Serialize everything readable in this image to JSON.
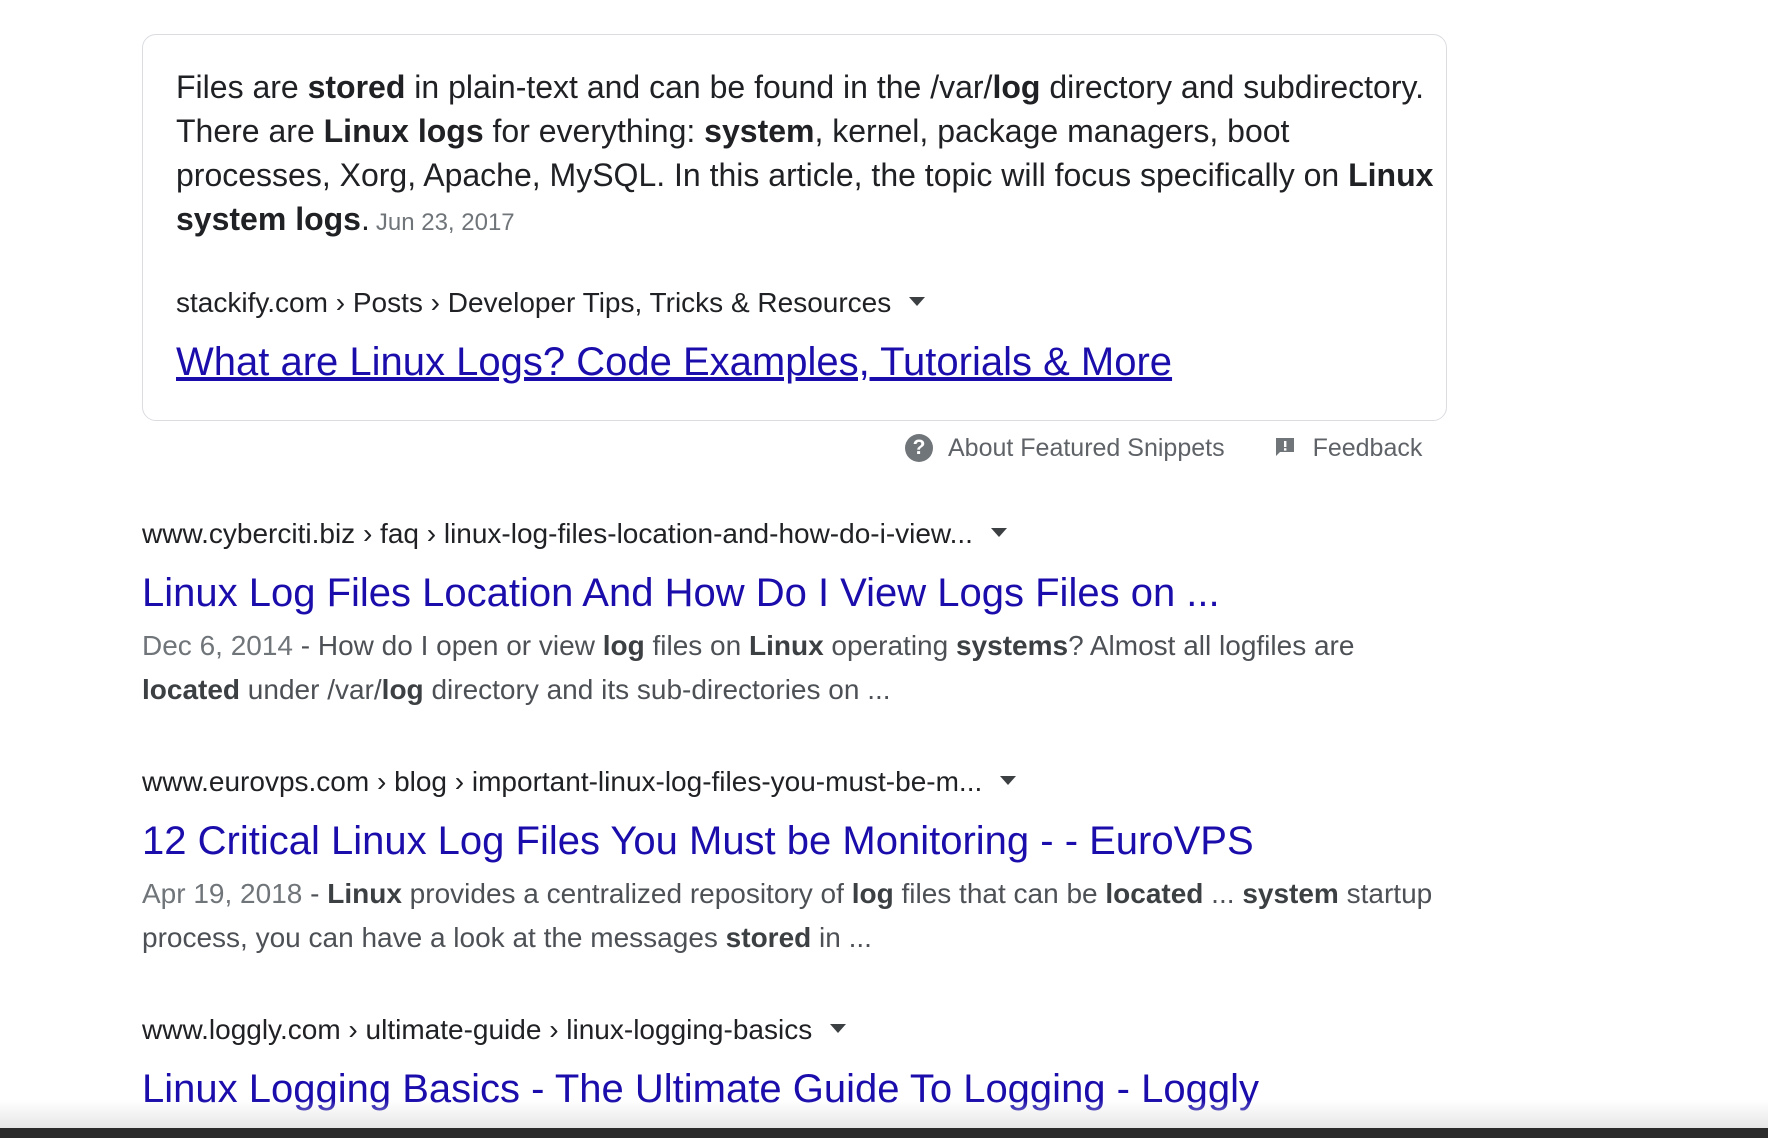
{
  "featured_snippet": {
    "text_segments": [
      {
        "t": "Files are ",
        "b": false
      },
      {
        "t": "stored",
        "b": true
      },
      {
        "t": " in plain-text and can be found in the /var/",
        "b": false
      },
      {
        "t": "log",
        "b": true
      },
      {
        "t": " directory and subdirectory. There are ",
        "b": false
      },
      {
        "t": "Linux logs",
        "b": true
      },
      {
        "t": " for everything: ",
        "b": false
      },
      {
        "t": "system",
        "b": true
      },
      {
        "t": ", kernel, package managers, boot processes, Xorg, Apache, MySQL. In this article, the topic will focus specifically on ",
        "b": false
      },
      {
        "t": "Linux system logs",
        "b": true
      },
      {
        "t": ".",
        "b": false
      }
    ],
    "date": "Jun 23, 2017",
    "cite": "stackify.com › Posts › Developer Tips, Tricks & Resources",
    "title": "What are Linux Logs? Code Examples, Tutorials & More"
  },
  "about_row": {
    "about_label": "About Featured Snippets",
    "feedback_label": "Feedback"
  },
  "results": [
    {
      "cite": "www.cyberciti.biz › faq › linux-log-files-location-and-how-do-i-view...",
      "title": "Linux Log Files Location And How Do I View Logs Files on ...",
      "date": "Dec 6, 2014",
      "separator": " - ",
      "desc_segments": [
        {
          "t": "How do I open or view ",
          "b": false
        },
        {
          "t": "log",
          "b": true
        },
        {
          "t": " files on ",
          "b": false
        },
        {
          "t": "Linux",
          "b": true
        },
        {
          "t": " operating ",
          "b": false
        },
        {
          "t": "systems",
          "b": true
        },
        {
          "t": "? Almost all logfiles are ",
          "b": false
        },
        {
          "t": "located",
          "b": true
        },
        {
          "t": " under /var/",
          "b": false
        },
        {
          "t": "log",
          "b": true
        },
        {
          "t": " directory and its sub-directories on ...",
          "b": false
        }
      ]
    },
    {
      "cite": "www.eurovps.com › blog › important-linux-log-files-you-must-be-m...",
      "title": "12 Critical Linux Log Files You Must be Monitoring - - EuroVPS",
      "date": "Apr 19, 2018",
      "separator": " - ",
      "desc_segments": [
        {
          "t": "Linux",
          "b": true
        },
        {
          "t": " provides a centralized repository of ",
          "b": false
        },
        {
          "t": "log",
          "b": true
        },
        {
          "t": " files that can be ",
          "b": false
        },
        {
          "t": "located",
          "b": true
        },
        {
          "t": " ... ",
          "b": false
        },
        {
          "t": "system",
          "b": true
        },
        {
          "t": " startup process, you can have a look at the messages ",
          "b": false
        },
        {
          "t": "stored",
          "b": true
        },
        {
          "t": " in ...",
          "b": false
        }
      ]
    },
    {
      "cite": "www.loggly.com › ultimate-guide › linux-logging-basics",
      "title": "Linux Logging Basics - The Ultimate Guide To Logging - Loggly",
      "date": "",
      "separator": "",
      "desc_segments": []
    }
  ],
  "colors": {
    "link": "#1a0dab",
    "text": "#202124",
    "muted": "#70757a"
  }
}
